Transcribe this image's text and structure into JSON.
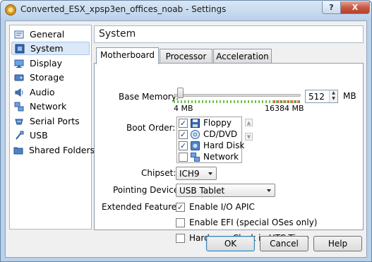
{
  "window": {
    "title": "Converted_ESX_xpsp3en_offices_noab - Settings",
    "help_label": "?",
    "close_label": "X"
  },
  "sidebar": {
    "items": [
      {
        "label": "General",
        "icon": "general-icon",
        "selected": false
      },
      {
        "label": "System",
        "icon": "system-icon",
        "selected": true
      },
      {
        "label": "Display",
        "icon": "display-icon",
        "selected": false
      },
      {
        "label": "Storage",
        "icon": "storage-icon",
        "selected": false
      },
      {
        "label": "Audio",
        "icon": "audio-icon",
        "selected": false
      },
      {
        "label": "Network",
        "icon": "network-icon",
        "selected": false
      },
      {
        "label": "Serial Ports",
        "icon": "serial-ports-icon",
        "selected": false
      },
      {
        "label": "USB",
        "icon": "usb-icon",
        "selected": false
      },
      {
        "label": "Shared Folders",
        "icon": "shared-folders-icon",
        "selected": false
      }
    ]
  },
  "page": {
    "heading": "System"
  },
  "tabs": [
    {
      "label": "Motherboard",
      "active": true
    },
    {
      "label": "Processor",
      "active": false
    },
    {
      "label": "Acceleration",
      "active": false
    }
  ],
  "motherboard": {
    "base_memory": {
      "label": "Base Memory:",
      "value": "512",
      "unit": "MB",
      "min_label": "4 MB",
      "max_label": "16384 MB",
      "fraction": 0.03
    },
    "boot_order": {
      "label": "Boot Order:",
      "items": [
        {
          "name": "Floppy",
          "checked": true,
          "icon": "floppy-icon"
        },
        {
          "name": "CD/DVD",
          "checked": true,
          "icon": "cd-dvd-icon"
        },
        {
          "name": "Hard Disk",
          "checked": true,
          "icon": "hard-disk-icon"
        },
        {
          "name": "Network",
          "checked": false,
          "icon": "network-boot-icon"
        }
      ]
    },
    "chipset": {
      "label": "Chipset:",
      "value": "ICH9"
    },
    "pointing_device": {
      "label": "Pointing Device:",
      "value": "USB Tablet"
    },
    "extended_features": {
      "label": "Extended Features:",
      "items": [
        {
          "label": "Enable I/O APIC",
          "checked": true
        },
        {
          "label": "Enable EFI (special OSes only)",
          "checked": false
        },
        {
          "label": "Hardware Clock in UTC Time",
          "checked": false
        }
      ]
    }
  },
  "buttons": {
    "ok": "OK",
    "cancel": "Cancel",
    "help": "Help"
  },
  "colors": {
    "titlebar": "#bcd2ea",
    "accent": "#3c7fb1",
    "checkmark": "#1c3f8a",
    "scale_green": "#6cc24a",
    "scale_red": "#e35a5a"
  }
}
